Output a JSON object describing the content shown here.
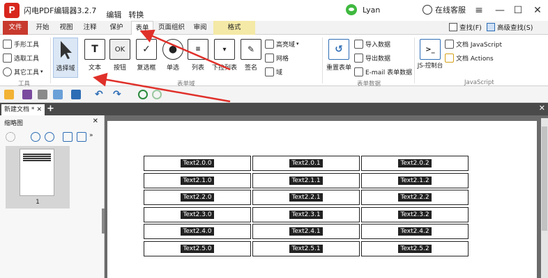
{
  "app": {
    "title": "闪电PDF编辑器3.2.7",
    "menu_edit": "编辑",
    "menu_convert": "转换",
    "logo_glyph": "P",
    "user": "Lyan",
    "service": "在线客服"
  },
  "tabs": [
    {
      "label": "文件",
      "style": "file"
    },
    {
      "label": "开始",
      "style": ""
    },
    {
      "label": "视图",
      "style": ""
    },
    {
      "label": "注释",
      "style": ""
    },
    {
      "label": "保护",
      "style": ""
    },
    {
      "label": "表单",
      "style": "active"
    },
    {
      "label": "页面组织",
      "style": ""
    },
    {
      "label": "审阅",
      "style": ""
    },
    {
      "label": "格式",
      "style": "format"
    }
  ],
  "right_tools": {
    "find": "查找(F)",
    "advanced_find": "高级查找(S)"
  },
  "ribbon": {
    "tools_group": {
      "label": "工具",
      "hand": "手形工具",
      "select": "选取工具",
      "other": "其它工具"
    },
    "form_group": {
      "label": "表单域",
      "buttons": [
        "选择域",
        "文本",
        "按钮",
        "复选框",
        "单选",
        "列表",
        "下拉列表",
        "签名"
      ]
    },
    "field_props": {
      "highlight": "高亮域",
      "grid": "网格",
      "field": "域"
    },
    "data_group": {
      "label": "表单数据",
      "reset": "重置表单",
      "import": "导入数据",
      "export": "导出数据",
      "email": "E-mail 表单数据"
    },
    "js_group": {
      "label": "JavaScript",
      "console": "JS-控制台",
      "doc_js": "文档 JavaScript",
      "actions": "文档 Actions"
    }
  },
  "doc_tabs": {
    "name": "新建文档 *"
  },
  "thumbnail": {
    "title": "缩略图",
    "page_num": "1"
  },
  "fields": [
    [
      "Text2.0.0",
      "Text2.0.1",
      "Text2.0.2"
    ],
    [
      "Text2.1.0",
      "Text2.1.1",
      "Text2.1.2"
    ],
    [
      "Text2.2.0",
      "Text2.2.1",
      "Text2.2.2"
    ],
    [
      "Text2.3.0",
      "Text2.3.1",
      "Text2.3.2"
    ],
    [
      "Text2.4.0",
      "Text2.4.1",
      "Text2.4.2"
    ],
    [
      "Text2.5.0",
      "Text2.5.1",
      "Text2.5.2"
    ]
  ],
  "colors": {
    "accent_red": "#c83a2e",
    "arrow": "#e0302a",
    "format_tab": "#f4e9a6"
  }
}
